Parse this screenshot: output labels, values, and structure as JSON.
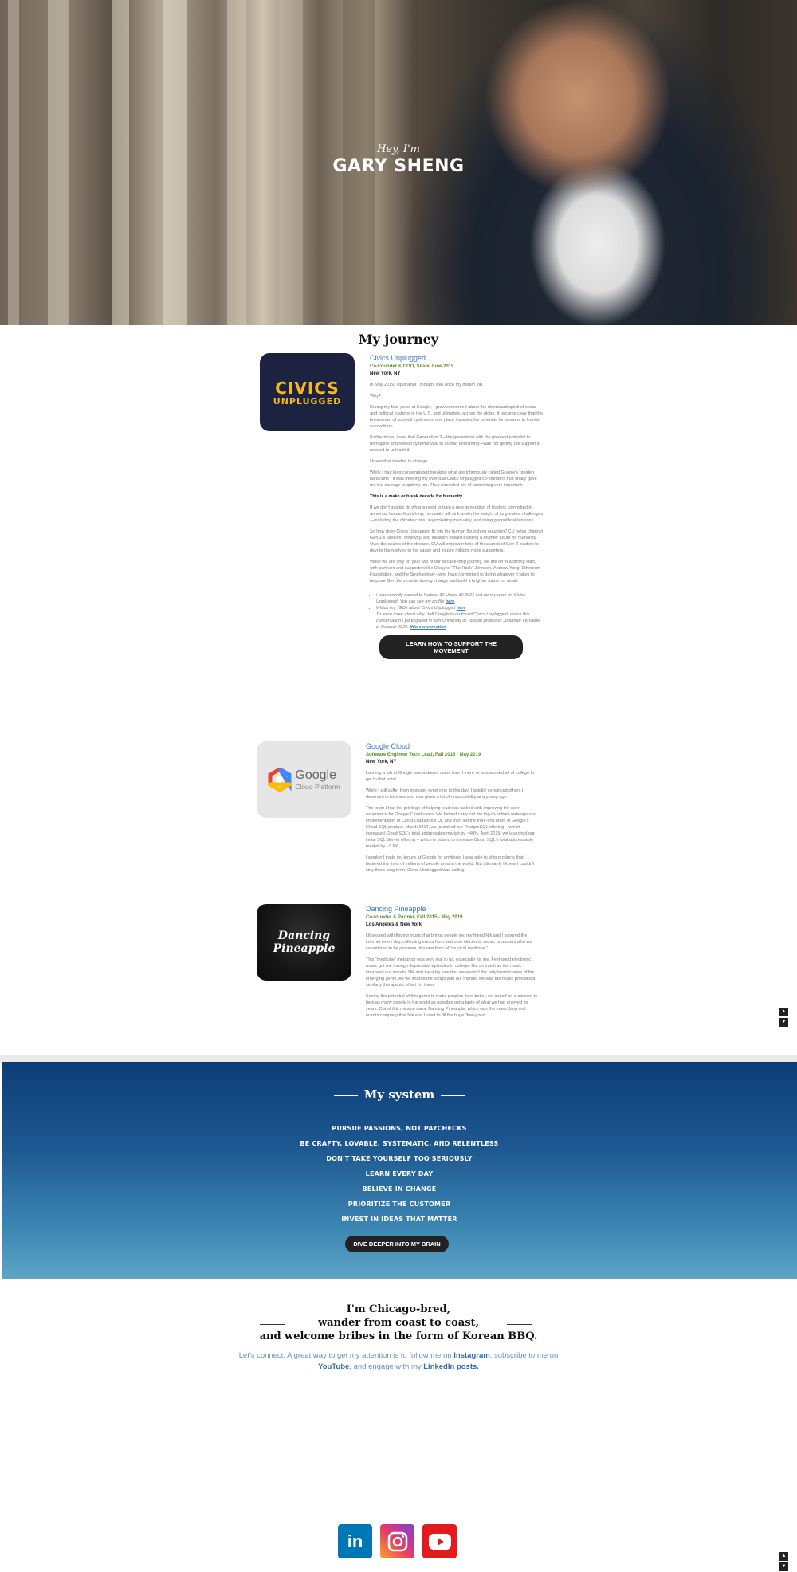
{
  "hero": {
    "greeting": "Hey, I'm",
    "name": "GARY SHENG"
  },
  "journey": {
    "title": "My journey",
    "entries": [
      {
        "logo": {
          "line1": "CIVICS",
          "line2": "UNPLUGGED"
        },
        "title": "Civics Unplugged",
        "role": "Co-Founder & COO, Since June 2019",
        "location": "New York, NY",
        "paragraphs": [
          "In May 2019, I quit what I thought was once my dream job.",
          "Why?",
          "During my four years at Google, I grew concerned about the downward spiral of social and political systems in the U.S. and ultimately, across the globe. It became clear that the breakdown of societal systems in one place impedes the potential for humans to flourish everywhere.",
          "Furthermore, I saw that Generation Z—the generation with the greatest potential to reimagine and rebuild systems vital to human flourishing—was not getting the support it needed to unleash it.",
          "I knew that needed to change.",
          "While I had long contemplated breaking what are infamously called Google's \"golden handcuffs\", it was meeting my eventual Civics Unplugged co-founders that finally gave me the courage to quit my job. They reminded me of something very important:",
          "This is a make or break decade for humanity.",
          "If we don't quickly do what is need to train a new generation of leaders committed to universal human flourishing, humanity will sink under the weight of its greatest challenges—including the climate crisis, skyrocketing inequality, and rising geopolitical tensions.",
          "So how does Civics Unplugged fit into the human flourishing equation? CU helps channel Gen Z's passion, creativity, and idealism toward building a brighter future for humanity. Over the course of the decade, CU will empower tens of thousands of Gen Z leaders to devote themselves to the cause and inspire millions more supporters.",
          "While we are only on year two of our decade-long journey, we are off to a strong start, with partners and supporters like Dwayne \"The Rock\" Johnson, Andrew Yang, Ethereum Foundation, and the Smithsonian—who have committed to doing whatever it takes to help our Gen Zers create lasting change and build a brighter future for us all."
        ],
        "bullets": [
          {
            "text": "I was recently named to Forbes' 30 Under 30 2021 List for my work on Civics Unplugged. You can see my profile ",
            "link": "here"
          },
          {
            "text": "Watch my TEDx about Civics Unplugged ",
            "link": "here"
          },
          {
            "text": "To learn more about why I left Google to co-found Civics Unplugged, watch this conversation I participated in with University of Toronto professor Jonathan Vervaeke in October 2020: ",
            "link": "this conversation"
          }
        ],
        "button": "LEARN HOW TO SUPPORT THE MOVEMENT"
      },
      {
        "logo": {
          "line1": "Google",
          "line2": "Cloud Platform"
        },
        "title": "Google Cloud",
        "role": "Software Engineer Tech Lead, Fall 2015 - May 2019",
        "location": "New York, NY",
        "paragraphs": [
          "Landing a job at Google was a dream come true. I more or less worked all of college to get to that point.",
          "While I still suffer from imposter syndrome to this day, I quickly convinced others I deserved to be there and was given a lot of responsibility at a young age.",
          "The team I had the privilege of helping lead was tasked with improving the user experience for Google Cloud users. We helped carry out the top-to-bottom redesign and implementation of Cloud Datastore's UI, and then led the front-end team of Google's Cloud SQL product. March 2017, we launched our PostgreSQL offering – which increased Cloud SQL's total addressable market by ~40%. April 2019, we launched our initial SQL Server offering – which is poised to increase Cloud SQL's total addressable market by ~3 6X.",
          "I wouldn't trade my tenure at Google for anything. I was able to ship products that bettered the lives of millions of people around the world. But ultimately I knew I couldn't stay there long-term. Civics Unplugged was calling."
        ]
      },
      {
        "logo": {
          "line1": "Dancing",
          "line2": "Pineapple"
        },
        "title": "Dancing Pineapple",
        "role": "Co-founder & Partner, Fall 2015 - May 2019",
        "location": "Los Angeles & New York",
        "paragraphs": [
          "Obsessed with finding music that brings people joy, my friend Nik and I scoured the internet every day, collecting tracks from bedroom electronic music producers who we considered to be pioneers of a rare form of \"musical medicine.\"",
          "This \"medicine\" metaphor was very real to us, especially for me. Feel-good electronic music got me through depressive episodes in college. But as much as the music improved our moods, Nik and I quickly saw that we weren't the only beneficiaries of the emerging genre. As we shared the songs with our friends, we saw the music provided a similarly therapeutic effect for them.",
          "Seeing the potential of this genre to make peoples lives better, we set off on a mission to help as many people in the world as possible get a taste of what we had enjoyed for years. Out of this mission came Dancing Pineapple, which was the music blog and events company that Nik and I used to fill the huge \"feel-good"
        ]
      }
    ]
  },
  "system": {
    "title": "My system",
    "principles": [
      "PURSUE PASSIONS, NOT PAYCHECKS",
      "BE CRAFTY, LOVABLE, SYSTEMATIC, AND RELENTLESS",
      "DON'T TAKE YOURSELF TOO SERIOUSLY",
      "LEARN EVERY DAY",
      "BELIEVE IN CHANGE",
      "PRIORITIZE THE CUSTOMER",
      "INVEST IN IDEAS THAT MATTER"
    ],
    "button": "DIVE DEEPER INTO MY BRAIN"
  },
  "chicago": {
    "lines": [
      "I'm Chicago-bred,",
      "wander from coast to coast,",
      "and welcome bribes in the form of Korean BBQ."
    ],
    "connect_pre": "Let's connect. A great way to get my attention is to follow me on ",
    "instagram": "Instagram",
    "connect_mid1": ", subscribe to me on ",
    "youtube": "YouTube",
    "connect_mid2": ", and engage with my ",
    "linkedin": "LinkedIn posts.",
    "socials": {
      "linkedin": "in"
    }
  },
  "scroll": {
    "up": "▲",
    "down": "▼"
  },
  "colors": {
    "link": "#3a78c3",
    "role": "#5a8f2a",
    "dark_button": "#222222"
  }
}
